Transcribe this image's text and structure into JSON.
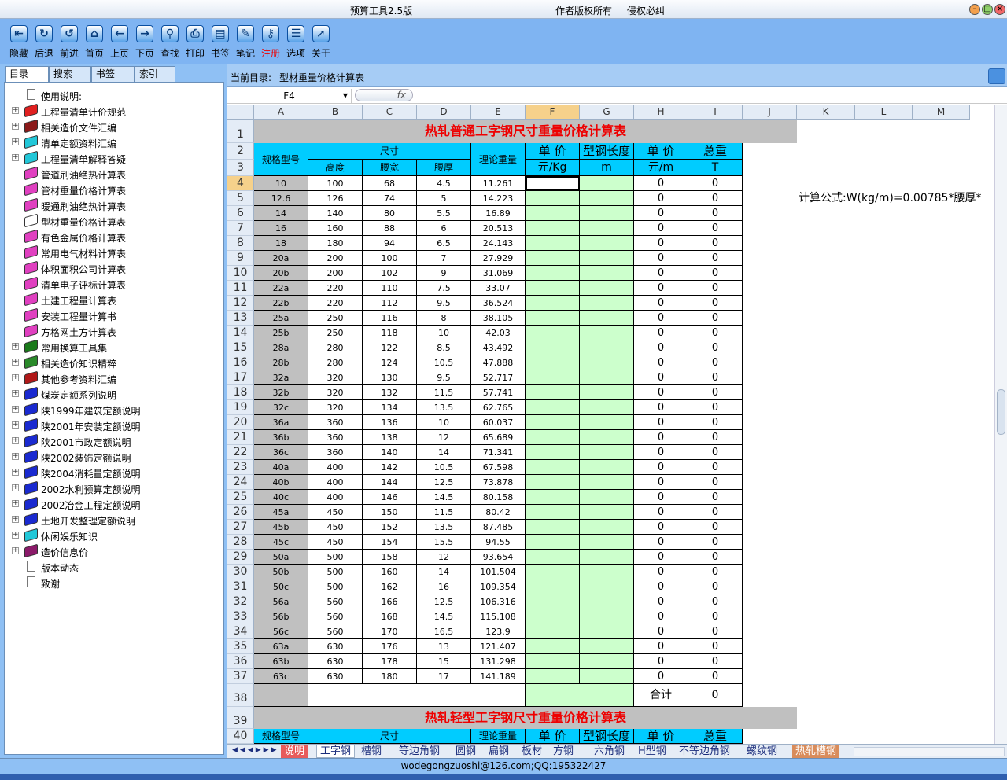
{
  "window": {
    "title": "预算工具2.5版",
    "author": "作者版权所有",
    "rights": "侵权必纠"
  },
  "toolbar": [
    {
      "label": "隐藏",
      "icon": "hide-icon",
      "glyph": "⇤",
      "color": ""
    },
    {
      "label": "后退",
      "icon": "back-icon",
      "glyph": "↻",
      "color": ""
    },
    {
      "label": "前进",
      "icon": "forward-icon",
      "glyph": "↺",
      "color": ""
    },
    {
      "label": "首页",
      "icon": "home-icon",
      "glyph": "⌂",
      "color": ""
    },
    {
      "label": "上页",
      "icon": "prev-page-icon",
      "glyph": "←",
      "color": ""
    },
    {
      "label": "下页",
      "icon": "next-page-icon",
      "glyph": "→",
      "color": ""
    },
    {
      "label": "查找",
      "icon": "search-icon",
      "glyph": "⚲",
      "color": ""
    },
    {
      "label": "打印",
      "icon": "print-icon",
      "glyph": "⎙",
      "color": ""
    },
    {
      "label": "书签",
      "icon": "bookmark-icon",
      "glyph": "▤",
      "color": ""
    },
    {
      "label": "笔记",
      "icon": "note-icon",
      "glyph": "✎",
      "color": ""
    },
    {
      "label": "注册",
      "icon": "register-icon",
      "glyph": "⚷",
      "color": "red"
    },
    {
      "label": "选项",
      "icon": "options-icon",
      "glyph": "☰",
      "color": ""
    },
    {
      "label": "关于",
      "icon": "about-icon",
      "glyph": "➚",
      "color": ""
    }
  ],
  "left_tabs": [
    "目录",
    "搜索",
    "书签",
    "索引"
  ],
  "tree": [
    {
      "label": "使用说明:",
      "type": "page",
      "expand": false,
      "color": ""
    },
    {
      "label": "工程量清单计价规范",
      "type": "book",
      "expand": true,
      "color": "#e02020"
    },
    {
      "label": "相关造价文件汇编",
      "type": "book",
      "expand": true,
      "color": "#8b1a1a"
    },
    {
      "label": "清单定额资料汇编",
      "type": "book",
      "expand": true,
      "color": "#22c7d8"
    },
    {
      "label": "工程量清单解释答疑",
      "type": "book",
      "expand": true,
      "color": "#22c7d8"
    },
    {
      "label": "管道刷油绝热计算表",
      "type": "book",
      "expand": false,
      "color": "#e040c0"
    },
    {
      "label": "管材重量价格计算表",
      "type": "book",
      "expand": false,
      "color": "#e040c0"
    },
    {
      "label": "暖通刷油绝热计算表",
      "type": "book",
      "expand": false,
      "color": "#e040c0"
    },
    {
      "label": "型材重量价格计算表",
      "type": "openbook",
      "expand": false,
      "color": "#ffffff"
    },
    {
      "label": "有色金属价格计算表",
      "type": "book",
      "expand": false,
      "color": "#e040c0"
    },
    {
      "label": "常用电气材料计算表",
      "type": "book",
      "expand": false,
      "color": "#e040c0"
    },
    {
      "label": "体积面积公司计算表",
      "type": "book",
      "expand": false,
      "color": "#e040c0"
    },
    {
      "label": "清单电子评标计算表",
      "type": "book",
      "expand": false,
      "color": "#e040c0"
    },
    {
      "label": "土建工程量计算表",
      "type": "book",
      "expand": false,
      "color": "#e040c0"
    },
    {
      "label": "安装工程量计算书",
      "type": "book",
      "expand": false,
      "color": "#e040c0"
    },
    {
      "label": "方格网土方计算表",
      "type": "book",
      "expand": false,
      "color": "#e040c0"
    },
    {
      "label": "常用换算工具集",
      "type": "book",
      "expand": true,
      "color": "#1a7a1a"
    },
    {
      "label": "相关造价知识精粹",
      "type": "book",
      "expand": true,
      "color": "#2a8a2a"
    },
    {
      "label": "其他参考资料汇编",
      "type": "book",
      "expand": true,
      "color": "#b01818"
    },
    {
      "label": "煤炭定额系列说明",
      "type": "book",
      "expand": true,
      "color": "#1a2ad0"
    },
    {
      "label": "陕1999年建筑定额说明",
      "type": "book",
      "expand": true,
      "color": "#1a2ad0"
    },
    {
      "label": "陕2001年安装定额说明",
      "type": "book",
      "expand": true,
      "color": "#1a2ad0"
    },
    {
      "label": "陕2001市政定额说明",
      "type": "book",
      "expand": true,
      "color": "#1a2ad0"
    },
    {
      "label": "陕2002装饰定额说明",
      "type": "book",
      "expand": true,
      "color": "#1a2ad0"
    },
    {
      "label": "陕2004消耗量定额说明",
      "type": "book",
      "expand": true,
      "color": "#1a2ad0"
    },
    {
      "label": "2002水利预算定额说明",
      "type": "book",
      "expand": true,
      "color": "#1a2ad0"
    },
    {
      "label": "2002冶金工程定额说明",
      "type": "book",
      "expand": true,
      "color": "#1a2ad0"
    },
    {
      "label": "土地开发整理定额说明",
      "type": "book",
      "expand": true,
      "color": "#1a2ad0"
    },
    {
      "label": "休闲娱乐知识",
      "type": "book",
      "expand": true,
      "color": "#22c7d8"
    },
    {
      "label": "造价信息价",
      "type": "book",
      "expand": true,
      "color": "#8b1a6a"
    },
    {
      "label": "版本动态",
      "type": "page",
      "expand": false,
      "color": ""
    },
    {
      "label": "致谢",
      "type": "page",
      "expand": false,
      "color": ""
    }
  ],
  "path": {
    "label": "当前目录:",
    "value": "型材重量价格计算表"
  },
  "formula": {
    "name_box": "F4",
    "fx": "fx"
  },
  "sheet": {
    "columns": [
      "A",
      "B",
      "C",
      "D",
      "E",
      "F",
      "G",
      "H",
      "I",
      "J",
      "K",
      "L",
      "M"
    ],
    "selected_column": "F",
    "selected_row": 4,
    "title1": "热轧普通工字钢尺寸重量价格计算表",
    "title2": "热轧轻型工字钢尺寸重量价格计算表",
    "headers": {
      "spec": "规格型号",
      "size": "尺寸",
      "height": "高度",
      "waist_width": "腰宽",
      "waist_thick": "腰厚",
      "theo_weight": "理论重量",
      "unit_price": "单 价",
      "unit_price_unit": "元/Kg",
      "length": "型钢长度",
      "length_unit": "m",
      "unit_price2": "单 价",
      "unit_price2_unit": "元/m",
      "total_weight": "总重",
      "total_weight_unit": "T"
    },
    "formula_note": "计算公式:W(kg/m)=0.00785*腰厚*",
    "total_label": "合计",
    "total_value": "0",
    "rows": [
      [
        "10",
        "100",
        "68",
        "4.5",
        "11.261",
        "0",
        "0"
      ],
      [
        "12.6",
        "126",
        "74",
        "5",
        "14.223",
        "0",
        "0"
      ],
      [
        "14",
        "140",
        "80",
        "5.5",
        "16.89",
        "0",
        "0"
      ],
      [
        "16",
        "160",
        "88",
        "6",
        "20.513",
        "0",
        "0"
      ],
      [
        "18",
        "180",
        "94",
        "6.5",
        "24.143",
        "0",
        "0"
      ],
      [
        "20a",
        "200",
        "100",
        "7",
        "27.929",
        "0",
        "0"
      ],
      [
        "20b",
        "200",
        "102",
        "9",
        "31.069",
        "0",
        "0"
      ],
      [
        "22a",
        "220",
        "110",
        "7.5",
        "33.07",
        "0",
        "0"
      ],
      [
        "22b",
        "220",
        "112",
        "9.5",
        "36.524",
        "0",
        "0"
      ],
      [
        "25a",
        "250",
        "116",
        "8",
        "38.105",
        "0",
        "0"
      ],
      [
        "25b",
        "250",
        "118",
        "10",
        "42.03",
        "0",
        "0"
      ],
      [
        "28a",
        "280",
        "122",
        "8.5",
        "43.492",
        "0",
        "0"
      ],
      [
        "28b",
        "280",
        "124",
        "10.5",
        "47.888",
        "0",
        "0"
      ],
      [
        "32a",
        "320",
        "130",
        "9.5",
        "52.717",
        "0",
        "0"
      ],
      [
        "32b",
        "320",
        "132",
        "11.5",
        "57.741",
        "0",
        "0"
      ],
      [
        "32c",
        "320",
        "134",
        "13.5",
        "62.765",
        "0",
        "0"
      ],
      [
        "36a",
        "360",
        "136",
        "10",
        "60.037",
        "0",
        "0"
      ],
      [
        "36b",
        "360",
        "138",
        "12",
        "65.689",
        "0",
        "0"
      ],
      [
        "36c",
        "360",
        "140",
        "14",
        "71.341",
        "0",
        "0"
      ],
      [
        "40a",
        "400",
        "142",
        "10.5",
        "67.598",
        "0",
        "0"
      ],
      [
        "40b",
        "400",
        "144",
        "12.5",
        "73.878",
        "0",
        "0"
      ],
      [
        "40c",
        "400",
        "146",
        "14.5",
        "80.158",
        "0",
        "0"
      ],
      [
        "45a",
        "450",
        "150",
        "11.5",
        "80.42",
        "0",
        "0"
      ],
      [
        "45b",
        "450",
        "152",
        "13.5",
        "87.485",
        "0",
        "0"
      ],
      [
        "45c",
        "450",
        "154",
        "15.5",
        "94.55",
        "0",
        "0"
      ],
      [
        "50a",
        "500",
        "158",
        "12",
        "93.654",
        "0",
        "0"
      ],
      [
        "50b",
        "500",
        "160",
        "14",
        "101.504",
        "0",
        "0"
      ],
      [
        "50c",
        "500",
        "162",
        "16",
        "109.354",
        "0",
        "0"
      ],
      [
        "56a",
        "560",
        "166",
        "12.5",
        "106.316",
        "0",
        "0"
      ],
      [
        "56b",
        "560",
        "168",
        "14.5",
        "115.108",
        "0",
        "0"
      ],
      [
        "56c",
        "560",
        "170",
        "16.5",
        "123.9",
        "0",
        "0"
      ],
      [
        "63a",
        "630",
        "176",
        "13",
        "121.407",
        "0",
        "0"
      ],
      [
        "63b",
        "630",
        "178",
        "15",
        "131.298",
        "0",
        "0"
      ],
      [
        "63c",
        "630",
        "180",
        "17",
        "141.189",
        "0",
        "0"
      ]
    ]
  },
  "sheet_tabs": [
    "说明",
    "工字钢",
    "槽钢",
    "等边角钢",
    "圆钢",
    "扁钢",
    "板材",
    "方钢",
    "六角钢",
    "H型钢",
    "不等边角钢",
    "螺纹钢",
    "热轧槽钢"
  ],
  "active_sheet_tab": "工字钢",
  "status": "wodegongzuoshi@126.com;QQ:195322427"
}
